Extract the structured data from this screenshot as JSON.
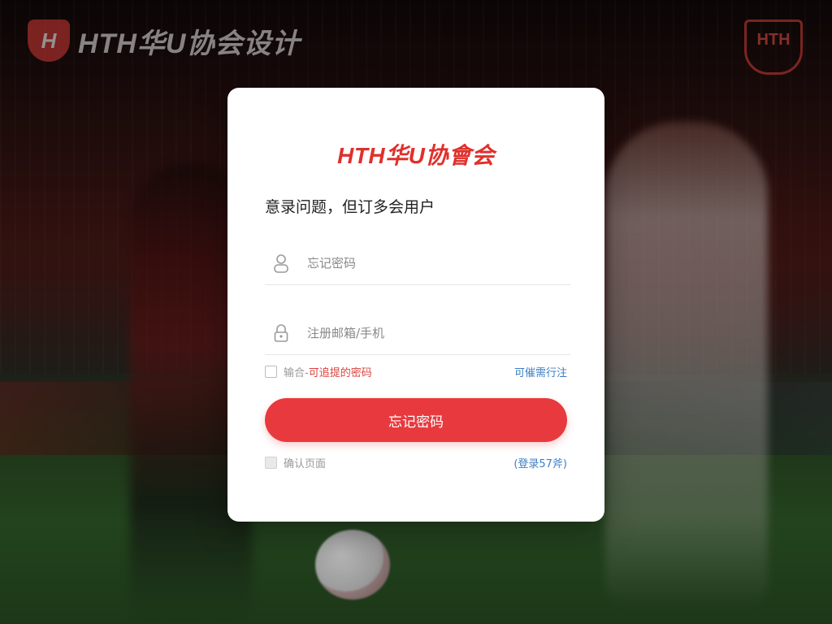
{
  "background": {
    "brand_text": "HTH华U协会设计",
    "shield_text": "HTH"
  },
  "card": {
    "logo": "HTH华U协會会",
    "subtitle": "意录问题，但订多会用户",
    "username": {
      "placeholder": "忘记密码",
      "value": "",
      "icon": "user-icon"
    },
    "password": {
      "placeholder": "注册邮箱/手机",
      "value": "",
      "icon": "lock-icon"
    },
    "remember": {
      "prefix": "输合-",
      "label": "可追提的密码",
      "checked": false
    },
    "forgot_link": "可催需行注",
    "submit_label": "忘记密码",
    "auto_page": {
      "label": "确认页面",
      "checked": false
    },
    "register_link": "(登录57斧)"
  },
  "colors": {
    "accent": "#e83a3e",
    "link": "#3d7ec4",
    "logo": "#e0302c"
  }
}
